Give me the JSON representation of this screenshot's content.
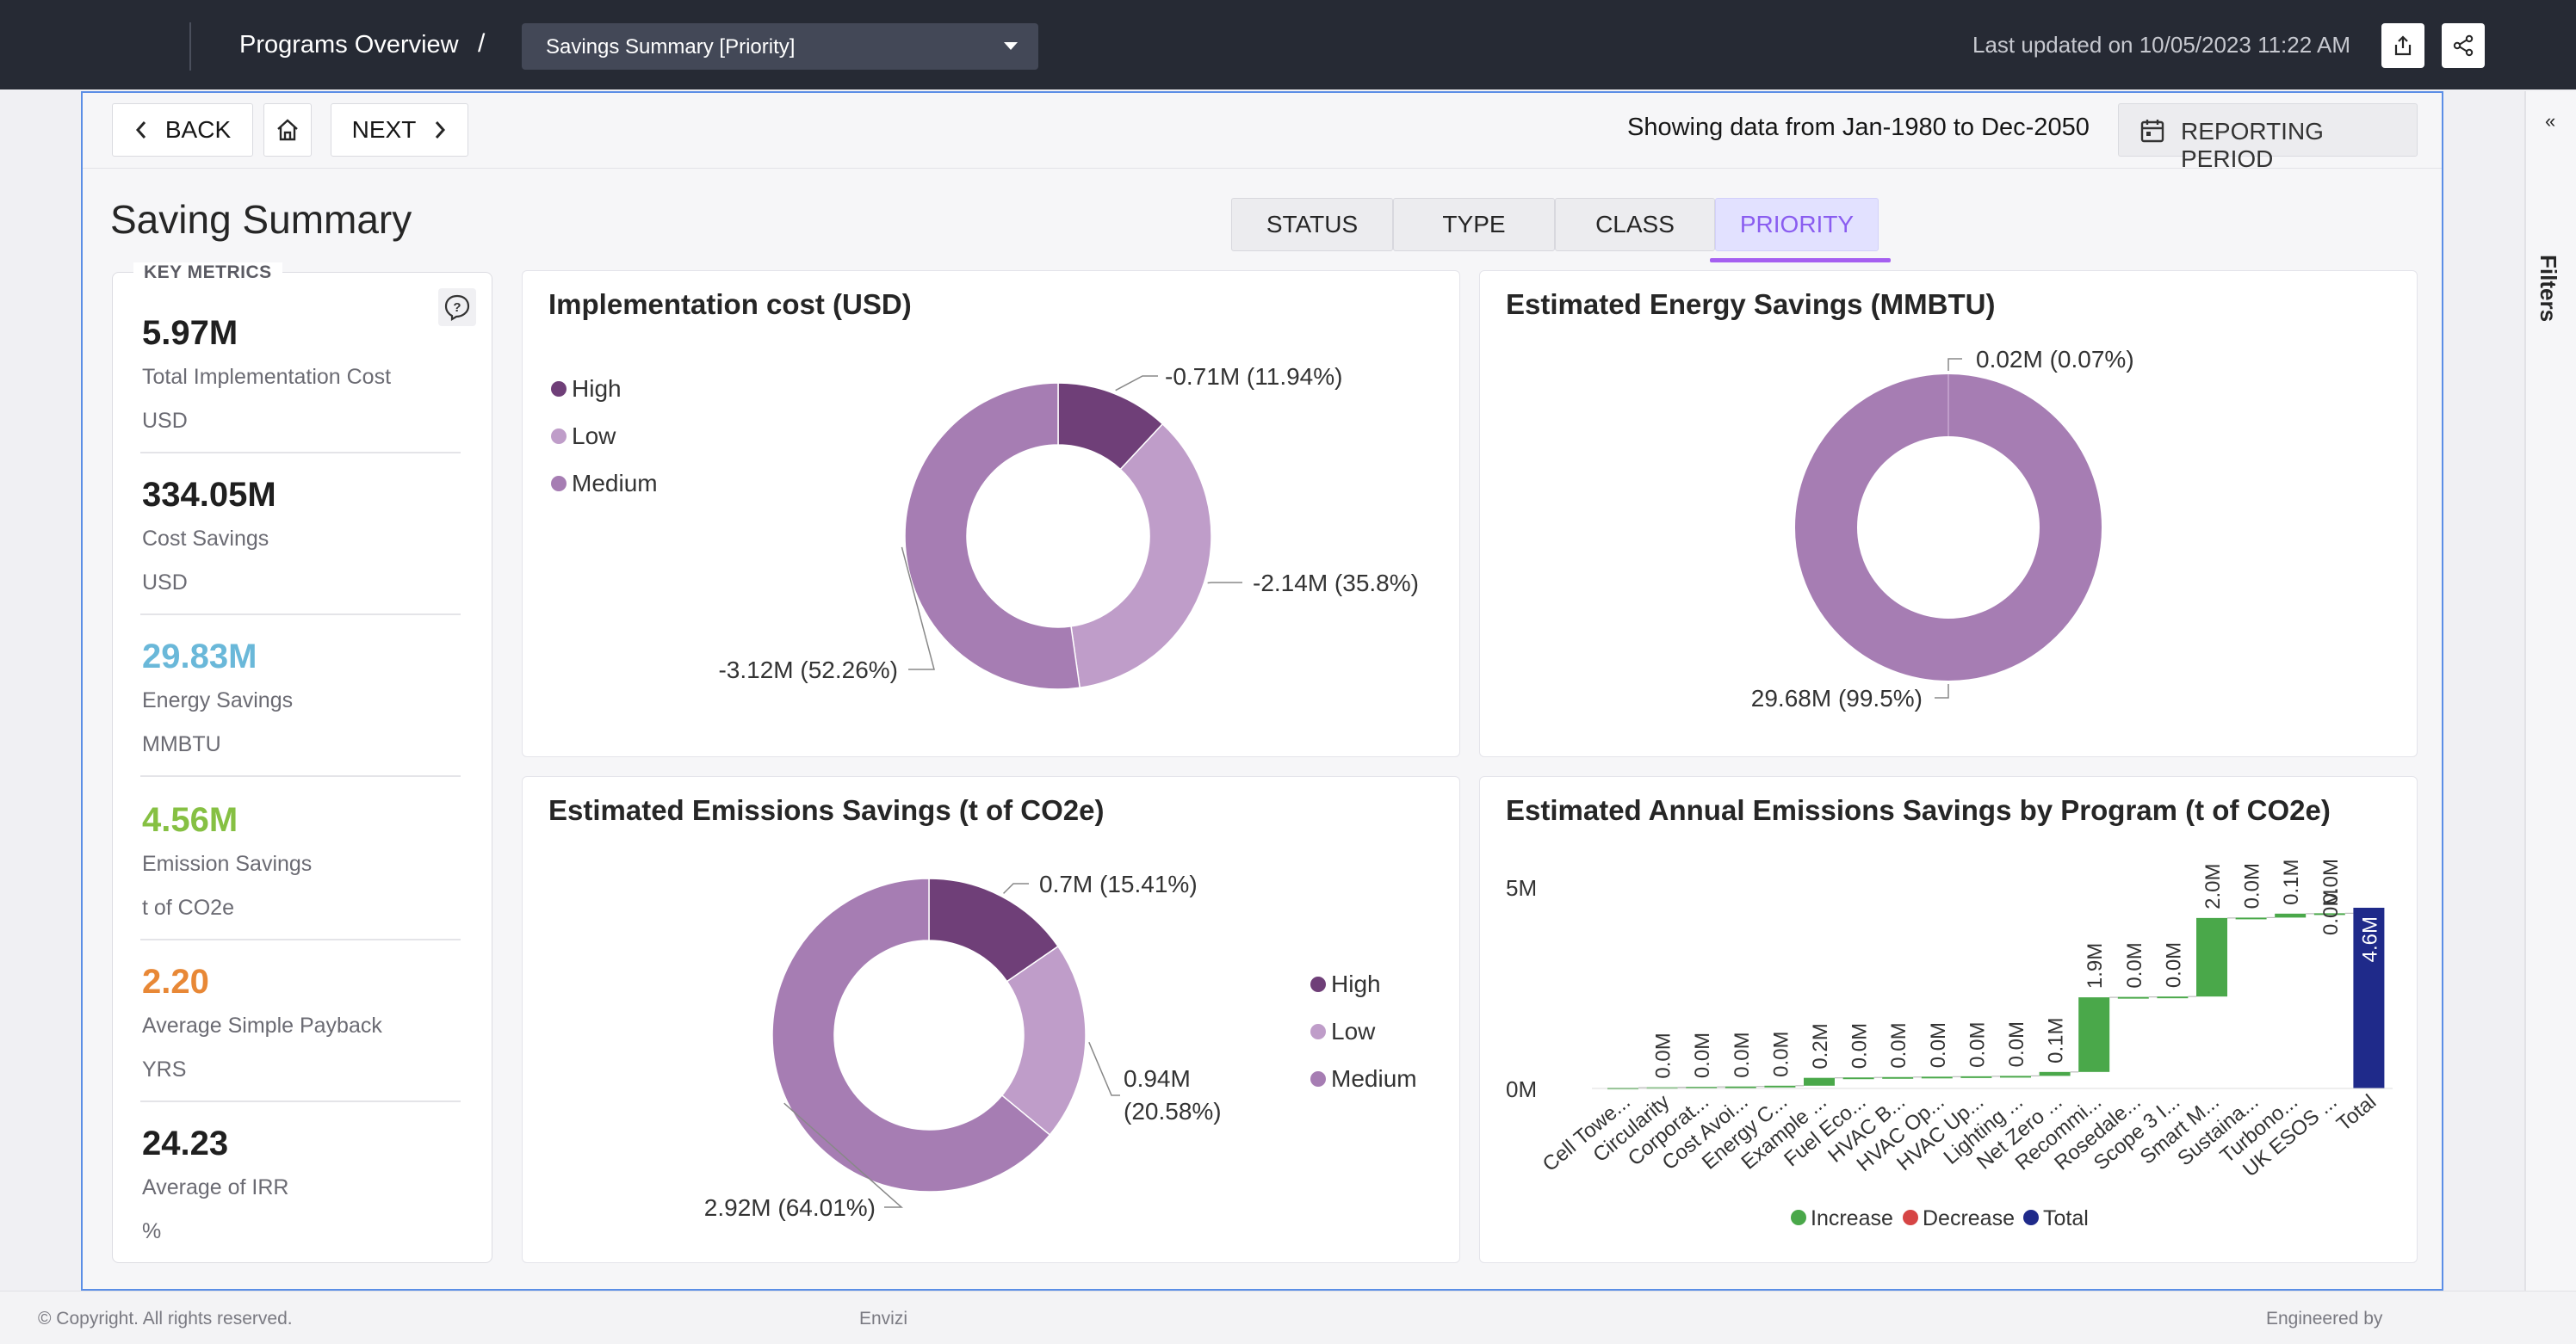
{
  "header": {
    "breadcrumb": "Programs Overview",
    "separator": "/",
    "dropdown_value": "Savings Summary [Priority]",
    "last_updated": "Last updated on 10/05/2023 11:22 AM"
  },
  "subbar": {
    "back_label": "BACK",
    "next_label": "NEXT",
    "showing_text": "Showing data from Jan-1980 to Dec-2050",
    "period_label": "REPORTING PERIOD"
  },
  "page": {
    "title": "Saving Summary",
    "tabs": [
      "STATUS",
      "TYPE",
      "CLASS",
      "PRIORITY"
    ],
    "active_tab": "PRIORITY",
    "accent": "#a55ff0"
  },
  "metrics": {
    "heading": "KEY METRICS",
    "items": [
      {
        "value": "5.97M",
        "label": "Total Implementation Cost",
        "unit": "USD",
        "color": "#1f1f1f"
      },
      {
        "value": "334.05M",
        "label": "Cost Savings",
        "unit": "USD",
        "color": "#1f1f1f"
      },
      {
        "value": "29.83M",
        "label": "Energy Savings",
        "unit": "MMBTU",
        "color": "#6ab8d9"
      },
      {
        "value": "4.56M",
        "label": "Emission Savings",
        "unit": "t of CO2e",
        "color": "#86c043"
      },
      {
        "value": "2.20",
        "label": "Average Simple Payback",
        "unit": "YRS",
        "color": "#e88836"
      },
      {
        "value": "24.23",
        "label": "Average of IRR",
        "unit": "%",
        "color": "#1f1f1f"
      }
    ]
  },
  "chart_data": [
    {
      "type": "pie",
      "title": "Implementation cost (USD)",
      "legend": [
        "High",
        "Low",
        "Medium"
      ],
      "slices": [
        {
          "label": "High",
          "value": -0.71,
          "percent": 11.94,
          "display": "-0.71M (11.94%)",
          "color": "#6f3f78"
        },
        {
          "label": "Low",
          "value": -2.14,
          "percent": 35.8,
          "display": "-2.14M (35.8%)",
          "color": "#bf9dc9"
        },
        {
          "label": "Medium",
          "value": -3.12,
          "percent": 52.26,
          "display": "-3.12M (52.26%)",
          "color": "#a67db3"
        }
      ]
    },
    {
      "type": "pie",
      "title": "Estimated Energy Savings (MMBTU)",
      "slices": [
        {
          "label": "Low",
          "value": 0.02,
          "percent": 0.07,
          "display": "0.02M (0.07%)",
          "color": "#bf9dc9"
        },
        {
          "label": "Medium",
          "value": 29.68,
          "percent": 99.5,
          "display": "29.68M (99.5%)",
          "color": "#a67db3"
        }
      ]
    },
    {
      "type": "pie",
      "title": "Estimated Emissions Savings (t of CO2e)",
      "legend": [
        "High",
        "Low",
        "Medium"
      ],
      "slices": [
        {
          "label": "High",
          "value": 0.7,
          "percent": 15.41,
          "display": "0.7M (15.41%)",
          "color": "#6f3f78"
        },
        {
          "label": "Low",
          "value": 0.94,
          "percent": 20.58,
          "display": "0.94M (20.58%)",
          "color": "#bf9dc9"
        },
        {
          "label": "Medium",
          "value": 2.92,
          "percent": 64.01,
          "display": "2.92M (64.01%)",
          "color": "#a67db3"
        }
      ]
    },
    {
      "type": "bar",
      "subtype": "waterfall",
      "title": "Estimated Annual Emissions Savings by Program (t of CO2e)",
      "ylim": [
        0,
        5
      ],
      "yticks": [
        "0M",
        "5M"
      ],
      "legend": [
        {
          "name": "Increase",
          "color": "#4aa84a"
        },
        {
          "name": "Decrease",
          "color": "#d64545"
        },
        {
          "name": "Total",
          "color": "#1f2a8a"
        }
      ],
      "categories": [
        "Cell Towe...",
        "Circularity",
        "Corporat...",
        "Cost Avoi...",
        "Energy C...",
        "Example ...",
        "Fuel Eco...",
        "HVAC B...",
        "HVAC Op...",
        "HVAC Up...",
        "Lighting ...",
        "Net Zero ...",
        "Recommi...",
        "Rosedale...",
        "Scope 3 I...",
        "Smart M...",
        "Sustaina...",
        "Turbono...",
        "UK ESOS ...",
        "Total"
      ],
      "values": [
        0.02,
        0.01,
        0.01,
        0.01,
        0.02,
        0.2,
        0.01,
        0.01,
        0.01,
        0.01,
        0.01,
        0.1,
        1.9,
        0.01,
        0.01,
        2.0,
        0.01,
        0.1,
        0.01,
        4.6
      ],
      "labels": [
        "",
        "0.0M",
        "0.0M",
        "0.0M",
        "0.0M",
        "0.2M",
        "0.0M",
        "0.0M",
        "0.0M",
        "0.0M",
        "0.0M",
        "0.1M",
        "1.9M",
        "0.0M",
        "0.0M",
        "2.0M",
        "0.0M",
        "0.1M",
        "0.0M",
        "4.6M"
      ],
      "extra_label": "0.0M"
    }
  ],
  "footer": {
    "copyright": "© Copyright. All rights reserved.",
    "brand": "Envizi",
    "engineered": "Engineered by"
  },
  "filters": {
    "label": "Filters"
  }
}
